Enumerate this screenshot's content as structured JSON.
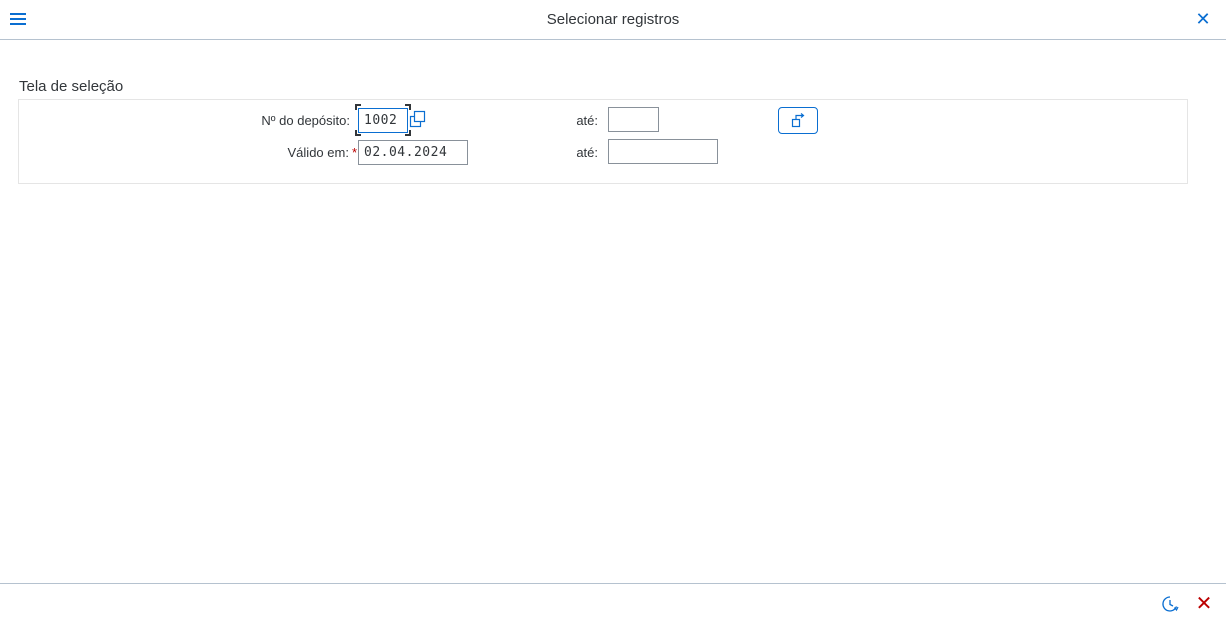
{
  "header": {
    "title": "Selecionar registros",
    "menu_icon": "hamburger-menu-icon",
    "close_icon": "close-icon"
  },
  "selection": {
    "section_title": "Tela de seleção",
    "deposit": {
      "label": "Nº do depósito:",
      "from_value": "1002",
      "to_label": "até:",
      "to_value": ""
    },
    "valid_on": {
      "label": "Válido em:",
      "required_mark": "*",
      "from_value": "02.04.2024",
      "to_label": "até:",
      "to_value": ""
    }
  },
  "footer": {
    "history_icon": "history-clock-icon",
    "cancel_icon": "cancel-icon"
  },
  "colors": {
    "accent": "#0a6ed1",
    "required": "#bb0000",
    "text": "#32363a"
  }
}
